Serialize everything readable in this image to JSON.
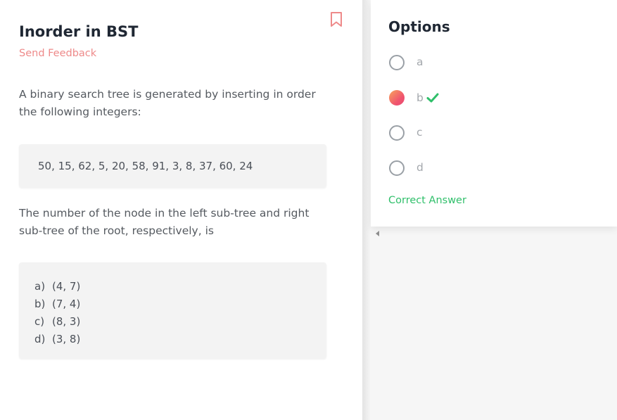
{
  "question": {
    "title": "Inorder in BST",
    "feedback_link": "Send Feedback",
    "intro": "A binary search tree is generated by inserting in order the following integers:",
    "sequence": "50, 15, 62, 5, 20, 58, 91, 3, 8, 37, 60, 24",
    "prompt": "The number of the node in the left sub-tree and right sub-tree of the root, respectively, is",
    "choices": [
      {
        "letter": "a)",
        "text": "(4, 7)"
      },
      {
        "letter": "b)",
        "text": "(7, 4)"
      },
      {
        "letter": "c)",
        "text": "(8, 3)"
      },
      {
        "letter": "d)",
        "text": "(3, 8)"
      }
    ],
    "bookmark_icon": "bookmark-icon"
  },
  "options": {
    "title": "Options",
    "items": [
      {
        "label": "a",
        "selected": false
      },
      {
        "label": "b",
        "selected": true,
        "correct": true
      },
      {
        "label": "c",
        "selected": false
      },
      {
        "label": "d",
        "selected": false
      }
    ],
    "result_text": "Correct Answer"
  },
  "colors": {
    "accent_feedback": "#ee8a8a",
    "correct_green": "#2fbf6a",
    "title_dark": "#1f2733"
  }
}
